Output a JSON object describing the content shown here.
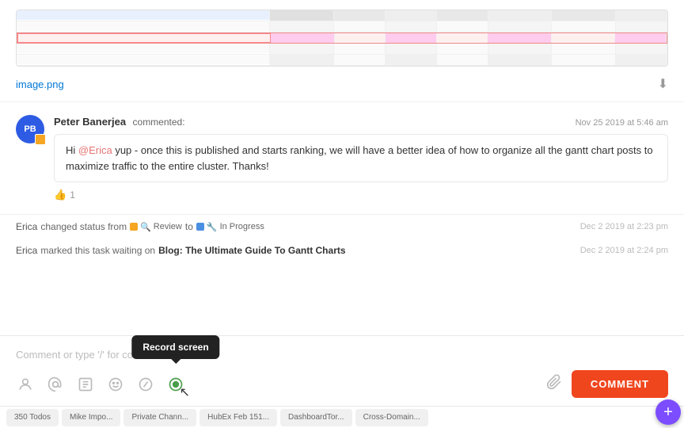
{
  "image": {
    "filename": "image.png",
    "download_tooltip": "Download"
  },
  "comment": {
    "author": "Peter Banerjea",
    "action": "commented:",
    "date": "Nov 25 2019 at 5:46 am",
    "text_pre": "Hi ",
    "mention": "@Erica",
    "text_post": " yup - once this is published and starts ranking, we will have a better idea of how to organize all the gantt chart posts to maximize traffic to the entire cluster. Thanks!",
    "likes": "1",
    "avatar_initials": "PB"
  },
  "activity": [
    {
      "actor": "Erica",
      "action": "changed status from",
      "from_status": "Review",
      "to": "to",
      "to_status": "In Progress",
      "date": "Dec 2 2019 at 2:23 pm"
    },
    {
      "actor": "Erica",
      "action": "marked this task waiting on",
      "task_link": "Blog: The Ultimate Guide To Gantt Charts",
      "date": "Dec 2 2019 at 2:24 pm"
    }
  ],
  "comment_input": {
    "placeholder": "Comment or type '/' for commands",
    "comment_button": "COMMENT"
  },
  "toolbar": {
    "icons": [
      "person-icon",
      "at-icon",
      "emoji-sticker-icon",
      "emoji-icon",
      "slash-icon",
      "record-icon",
      "attach-icon"
    ],
    "record_tooltip": "Record screen"
  },
  "bottom_tabs": [
    "350 Todos",
    "Mike Impo...",
    "Private Chann...",
    "HubEx Feb 151...",
    "DashboardTor...",
    "Cross-Domain..."
  ],
  "fab": {
    "label": "+"
  }
}
